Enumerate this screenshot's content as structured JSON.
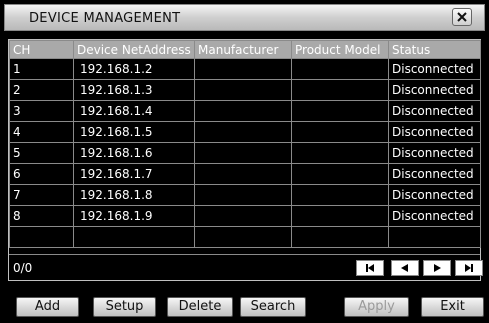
{
  "window": {
    "title": "DEVICE MANAGEMENT",
    "close_icon": "close-icon"
  },
  "table": {
    "columns": [
      "CH",
      "Device NetAddress",
      "Manufacturer",
      "Product Model",
      "Status"
    ],
    "rows": [
      {
        "ch": "1",
        "address": "192.168.1.2",
        "manufacturer": "",
        "model": "",
        "status": "Disconnected"
      },
      {
        "ch": "2",
        "address": "192.168.1.3",
        "manufacturer": "",
        "model": "",
        "status": "Disconnected"
      },
      {
        "ch": "3",
        "address": "192.168.1.4",
        "manufacturer": "",
        "model": "",
        "status": "Disconnected"
      },
      {
        "ch": "4",
        "address": "192.168.1.5",
        "manufacturer": "",
        "model": "",
        "status": "Disconnected"
      },
      {
        "ch": "5",
        "address": "192.168.1.6",
        "manufacturer": "",
        "model": "",
        "status": "Disconnected"
      },
      {
        "ch": "6",
        "address": "192.168.1.7",
        "manufacturer": "",
        "model": "",
        "status": "Disconnected"
      },
      {
        "ch": "7",
        "address": "192.168.1.8",
        "manufacturer": "",
        "model": "",
        "status": "Disconnected"
      },
      {
        "ch": "8",
        "address": "192.168.1.9",
        "manufacturer": "",
        "model": "",
        "status": "Disconnected"
      },
      {
        "ch": "",
        "address": "",
        "manufacturer": "",
        "model": "",
        "status": ""
      }
    ]
  },
  "pager": {
    "count": "0/0",
    "icons": [
      "first-page-icon",
      "prev-page-icon",
      "next-page-icon",
      "last-page-icon"
    ]
  },
  "buttons": {
    "add": "Add",
    "setup": "Setup",
    "delete": "Delete",
    "search": "Search",
    "apply": "Apply",
    "exit": "Exit"
  },
  "colors": {
    "background": "#000000",
    "header": "#a9a9a9",
    "grid": "#8a8a8a",
    "text": "#ffffff"
  }
}
